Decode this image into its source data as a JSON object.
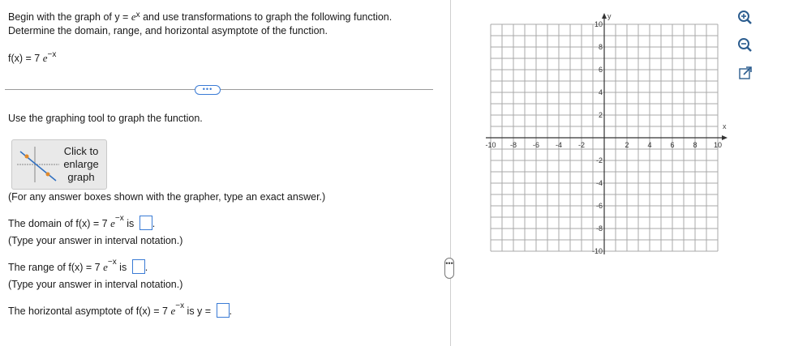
{
  "question": {
    "instruction_line1_a": "Begin with the graph of y = ",
    "instruction_e": "e",
    "instruction_exp": "x",
    "instruction_line1_b": " and use transformations to graph the following function.",
    "instruction_line2": "Determine the domain, range, and horizontal asymptote of the function.",
    "func_prefix": "f(x) = 7 ",
    "func_e": "e",
    "func_exp": "−x"
  },
  "expand_dots": "•••",
  "graph_tool_text": "Use the graphing tool to graph the function.",
  "enlarge_button": {
    "line1": "Click to",
    "line2": "enlarge",
    "line3": "graph"
  },
  "exact_note": "(For any answer boxes shown with the grapher, type an exact answer.)",
  "domain": {
    "prefix": "The domain of f(x) = 7 ",
    "e": "e",
    "exp": "−x",
    "suffix": " is ",
    "end": ".",
    "hint": "(Type your answer in interval notation.)"
  },
  "range": {
    "prefix": "The range of f(x) = 7 ",
    "e": "e",
    "exp": "−x",
    "suffix": " is ",
    "end": ".",
    "hint": "(Type your answer in interval notation.)"
  },
  "asymptote": {
    "prefix": "The horizontal asymptote of f(x) = 7 ",
    "e": "e",
    "exp": "−x",
    "suffix": " is y = ",
    "end": "."
  },
  "split_handle": "•••",
  "graph": {
    "x_axis_label": "x",
    "y_axis_label": "y",
    "x_range": [
      -10,
      10
    ],
    "y_range": [
      -10,
      10
    ],
    "x_tick_labels": [
      "-10",
      "-8",
      "-6",
      "-4",
      "-2",
      "2",
      "4",
      "6",
      "8",
      "10"
    ],
    "y_tick_labels": [
      "10",
      "8",
      "6",
      "4",
      "2",
      "-2",
      "-4",
      "-6",
      "-8",
      "-10"
    ],
    "grid_step": 1
  },
  "tools": [
    "zoom-in-icon",
    "zoom-out-icon",
    "popout-icon"
  ],
  "colors": {
    "accent": "#3a7bd5",
    "grid": "#a8a8a8",
    "axis": "#333333"
  }
}
